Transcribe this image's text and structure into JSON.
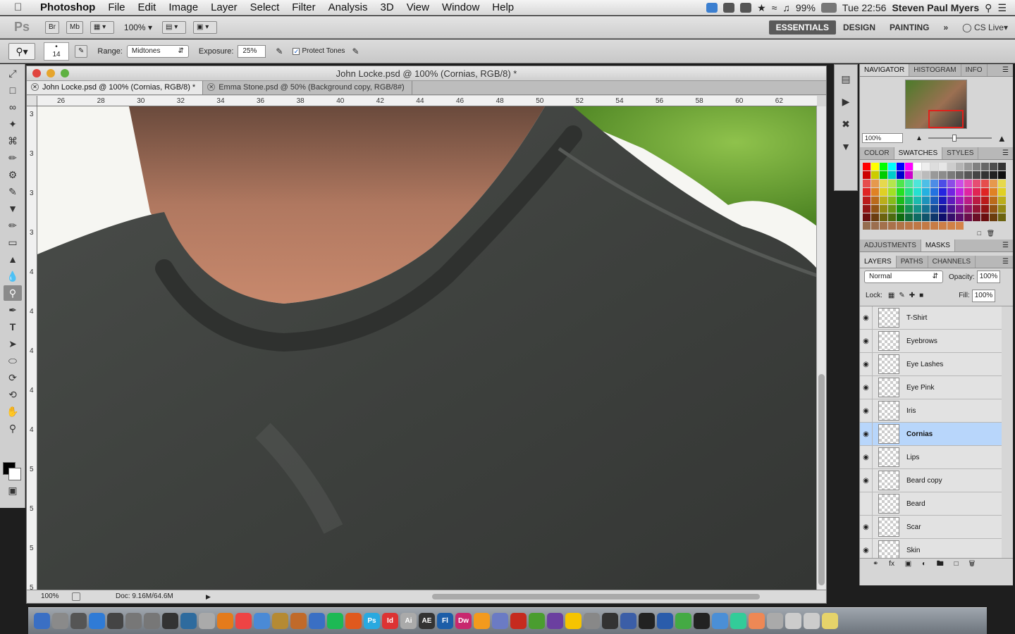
{
  "menubar": {
    "apple": "",
    "items": [
      "Photoshop",
      "File",
      "Edit",
      "Image",
      "Layer",
      "Select",
      "Filter",
      "Analysis",
      "3D",
      "View",
      "Window",
      "Help"
    ],
    "battery": "99%",
    "time": "Tue 22:56",
    "user": "Steven Paul Myers"
  },
  "appbar": {
    "logo": "Ps",
    "br": "Br",
    "mb": "Mb",
    "zoom": "100%",
    "workspaces": [
      "ESSENTIALS",
      "DESIGN",
      "PAINTING"
    ],
    "more": "»",
    "cslive": "CS Live"
  },
  "options": {
    "brush_size": "14",
    "range_label": "Range:",
    "range_value": "Midtones",
    "exposure_label": "Exposure:",
    "exposure_value": "25%",
    "protect_label": "Protect Tones"
  },
  "document": {
    "title": "John Locke.psd @ 100% (Cornias, RGB/8) *",
    "tabs": [
      "John Locke.psd @ 100% (Cornias, RGB/8) *",
      "Emma Stone.psd @ 50% (Background copy, RGB/8#)"
    ],
    "ruler_h": [
      "26",
      "28",
      "30",
      "32",
      "34",
      "36",
      "38",
      "40",
      "42",
      "44",
      "46",
      "48",
      "50",
      "52",
      "54",
      "56",
      "58",
      "60",
      "62"
    ],
    "ruler_v": [
      "3",
      "3",
      "3",
      "3",
      "4",
      "4",
      "4",
      "4",
      "4",
      "5",
      "5",
      "5",
      "5",
      "5"
    ],
    "status_zoom": "100%",
    "status_doc": "Doc: 9.16M/64.6M"
  },
  "navigator": {
    "tabs": [
      "NAVIGATOR",
      "HISTOGRAM",
      "INFO"
    ],
    "zoom": "100%"
  },
  "color_panel": {
    "tabs": [
      "COLOR",
      "SWATCHES",
      "STYLES"
    ]
  },
  "adjust_panel": {
    "tabs": [
      "ADJUSTMENTS",
      "MASKS"
    ]
  },
  "layers_panel": {
    "tabs": [
      "LAYERS",
      "PATHS",
      "CHANNELS"
    ],
    "blend_mode": "Normal",
    "opacity_label": "Opacity:",
    "opacity": "100%",
    "lock_label": "Lock:",
    "fill_label": "Fill:",
    "fill": "100%",
    "layers": [
      {
        "name": "T-Shirt",
        "visible": true
      },
      {
        "name": "Eyebrows",
        "visible": true
      },
      {
        "name": "Eye Lashes",
        "visible": true
      },
      {
        "name": "Eye Pink",
        "visible": true
      },
      {
        "name": "Iris",
        "visible": true
      },
      {
        "name": "Cornias",
        "visible": true,
        "selected": true
      },
      {
        "name": "Lips",
        "visible": true
      },
      {
        "name": "Beard copy",
        "visible": true
      },
      {
        "name": "Beard",
        "visible": false
      },
      {
        "name": "Scar",
        "visible": true
      },
      {
        "name": "Skin",
        "visible": true
      }
    ]
  },
  "dock": [
    "Ps",
    "Id",
    "Ai",
    "AE",
    "Fl",
    "Dw"
  ]
}
